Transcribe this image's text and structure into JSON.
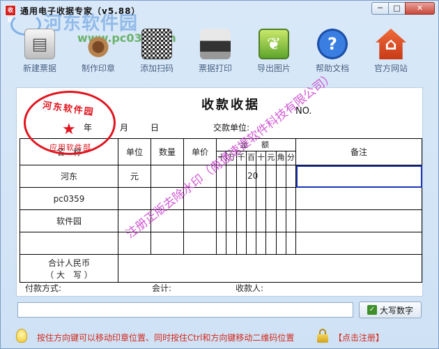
{
  "window": {
    "title": "通用电子收据专家（v5.88）",
    "app_icon_text": "收据",
    "minimize": "─",
    "maximize": "□",
    "close": "✕"
  },
  "watermark": {
    "site": "河东软件园",
    "url": "www.pc0359.cn",
    "diagonal": "注册正版去除水印（南通速提软件科技有限公司）"
  },
  "toolbar": [
    {
      "label": "新建票据",
      "icon": "printer-new-icon"
    },
    {
      "label": "制作印章",
      "icon": "stamp-icon"
    },
    {
      "label": "添加扫码",
      "icon": "qr-code-icon"
    },
    {
      "label": "票据打印",
      "icon": "printer-icon"
    },
    {
      "label": "导出图片",
      "icon": "picture-icon"
    },
    {
      "label": "帮助文档",
      "icon": "help-icon"
    },
    {
      "label": "官方网站",
      "icon": "home-icon"
    }
  ],
  "receipt": {
    "title": "收款收据",
    "no_label": "NO.",
    "year": "年",
    "month": "月",
    "day": "日",
    "payer_unit": "交款单位:",
    "headers": {
      "name": "名　称",
      "unit": "单位",
      "qty": "数量",
      "price": "单价",
      "amount": "金　额",
      "digits": [
        "十",
        "万",
        "千",
        "百",
        "十",
        "元",
        "角",
        "分"
      ],
      "remark": "备注"
    },
    "rows": [
      {
        "name": "河东",
        "unit": "元",
        "amount": "20"
      },
      {
        "name": "pc0359",
        "unit": "",
        "amount": ""
      },
      {
        "name": "软件园",
        "unit": "",
        "amount": ""
      },
      {
        "name": "",
        "unit": "",
        "amount": ""
      }
    ],
    "total_label_1": "合计人民币",
    "total_label_2": "（ 大　写 ）",
    "footer": {
      "pay_method": "付款方式:",
      "total": "会计:",
      "payee": "收款人:"
    }
  },
  "stamp": {
    "top_text": "河东软件园",
    "bottom_text": "应用软件部"
  },
  "bottom": {
    "input_value": "",
    "capitalize_button": "大写数字"
  },
  "status": {
    "hint": "按住方向键可以移动印章位置、同时按住Ctrl和方向键移动二维码位置",
    "register": "【点击注册】"
  }
}
